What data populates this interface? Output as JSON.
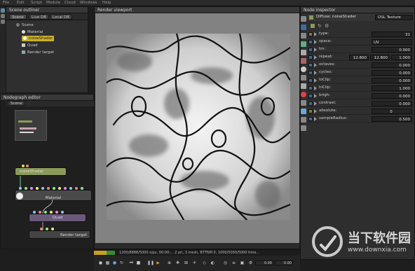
{
  "menu": [
    "File",
    "Edit",
    "Script",
    "Module",
    "Cloud",
    "Windows",
    "Help"
  ],
  "outliner": {
    "title": "Scene outliner",
    "tabs": [
      "Scene",
      "Live DB",
      "Local DB"
    ],
    "root": "Scene",
    "items": [
      "Material",
      "noiseShader",
      "Quad",
      "Render target"
    ]
  },
  "nodegraph": {
    "title": "Nodegraph editor",
    "tab": "Scene",
    "nodes": {
      "noise": "noiseShader",
      "material": "Material",
      "quad": "Quad",
      "render": "Render target"
    }
  },
  "viewport": {
    "title": "Render viewport",
    "status": "1200/8888/5000 s/px, 00:00:... 2 pri, 3 mesh, BTTNM 0, 1000/5000/5000 time...",
    "coords": [
      "0.00",
      "0.00"
    ]
  },
  "inspector": {
    "title": "Node inspector",
    "shader_name": "Diffuse: noiseShader",
    "shader_type": "OSL Texture",
    "props": [
      {
        "label": "type:",
        "values": [
          "31"
        ]
      },
      {
        "label": "space:",
        "values": [
          "UV"
        ]
      },
      {
        "label": "tm:",
        "values": [
          "0.000"
        ]
      },
      {
        "label": "repeat:",
        "values": [
          "12.800",
          "12.800",
          "1.000"
        ]
      },
      {
        "label": "octaves:",
        "values": [
          "0.000"
        ]
      },
      {
        "label": "cycles:",
        "values": [
          "0.000"
        ]
      },
      {
        "label": "loClip:",
        "values": [
          "0.000"
        ]
      },
      {
        "label": "hiClip:",
        "values": [
          "1.000"
        ]
      },
      {
        "label": "brigh:",
        "values": [
          "0.000"
        ]
      },
      {
        "label": "contrast:",
        "values": [
          "0.000"
        ]
      },
      {
        "label": "absolute:",
        "values": [
          "0"
        ]
      },
      {
        "label": "sampleRadius:",
        "values": [
          "0.500"
        ]
      }
    ]
  },
  "watermark": {
    "cn": "当下软件园",
    "url": "www.downxia.com"
  },
  "colors": {
    "accent": "#3d6c9b",
    "selected": "#c8b030",
    "node_noise": "#8a9a58",
    "node_quad": "#6a5a7a"
  }
}
